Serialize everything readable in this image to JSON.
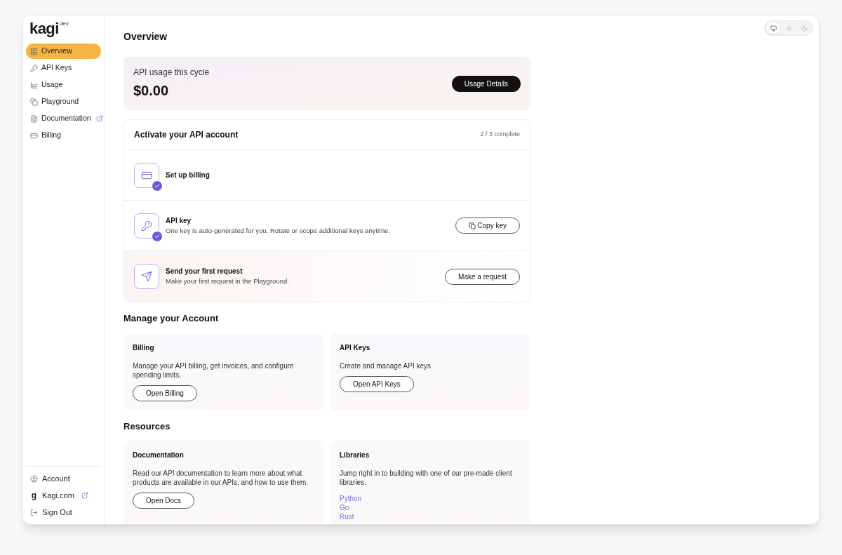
{
  "logo": {
    "name": "kagi",
    "badge": "dev"
  },
  "sidebar": {
    "items": [
      {
        "label": "Overview",
        "selected": true,
        "external": false
      },
      {
        "label": "API Keys",
        "selected": false,
        "external": false
      },
      {
        "label": "Usage",
        "selected": false,
        "external": false
      },
      {
        "label": "Playground",
        "selected": false,
        "external": false
      },
      {
        "label": "Documentation",
        "selected": false,
        "external": true
      },
      {
        "label": "Billing",
        "selected": false,
        "external": false
      }
    ],
    "footer": [
      {
        "label": "Account",
        "external": false
      },
      {
        "label": "Kagi.com",
        "glyph": "g",
        "external": true
      },
      {
        "label": "Sign Out",
        "external": false
      }
    ]
  },
  "theme_switch": [
    {
      "selected": true
    },
    {
      "selected": false
    },
    {
      "selected": false
    }
  ],
  "title": "Overview",
  "usage": {
    "label": "API usage this cycle",
    "amount": "$0.00",
    "button": "Usage Details"
  },
  "activation": {
    "title": "Activate your API account",
    "progress": "2 / 3 complete",
    "steps": [
      {
        "title": "Set up billing",
        "completed": true
      },
      {
        "title": "API key",
        "description": "One key is auto-generated for you. Rotate or scope additional keys anytime.",
        "button": "Copy key",
        "completed": true
      },
      {
        "title": "Send your first request",
        "description": "Make your first request in the Playground.",
        "button": "Make a request",
        "completed": false
      }
    ]
  },
  "sections": [
    {
      "title": "Manage your Account",
      "cards": [
        {
          "title": "Billing",
          "text": "Manage your API billing, get invoices, and configure spending limits.",
          "button": "Open Billing"
        },
        {
          "title": "API Keys",
          "text": "Create and manage API keys",
          "button": "Open API Keys"
        }
      ]
    },
    {
      "title": "Resources",
      "cards": [
        {
          "title": "Documentation",
          "text": "Read our API documentation to learn more about what products are available in our APIs, and how to use them.",
          "button": "Open Docs"
        },
        {
          "title": "Libraries",
          "text": "Jump right in to building with one of our pre-made client libraries.",
          "links": [
            "Python",
            "Go",
            "Rust"
          ]
        }
      ]
    }
  ]
}
